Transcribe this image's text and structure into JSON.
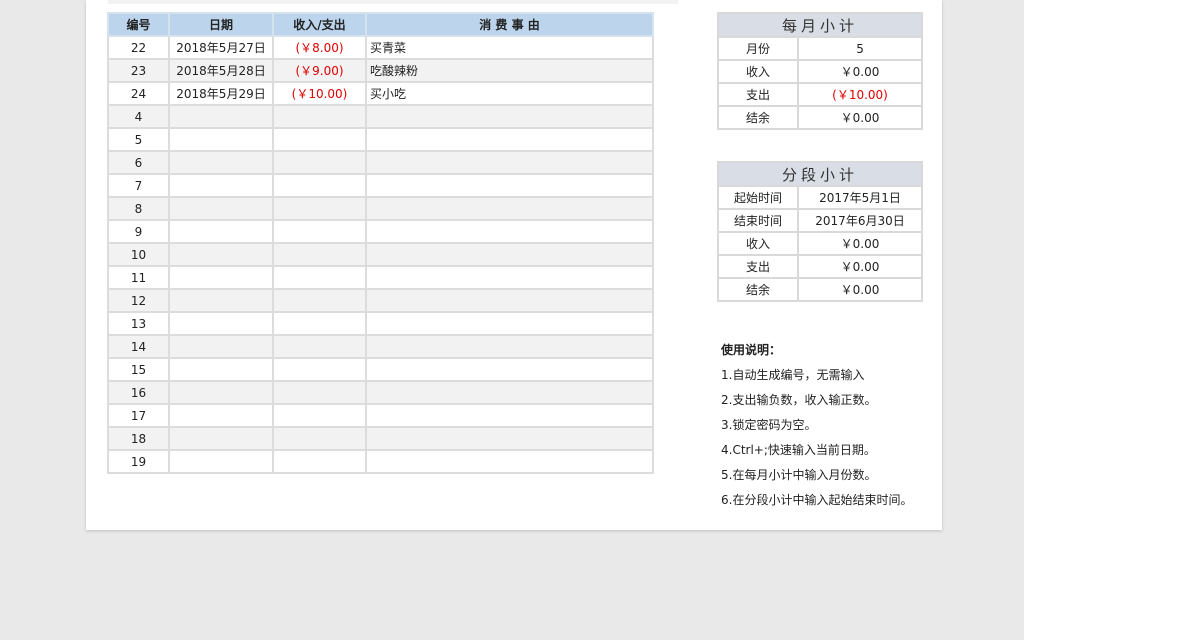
{
  "ledger": {
    "headers": {
      "no": "编号",
      "date": "日期",
      "amount": "收入/支出",
      "reason": "消 费 事 由"
    },
    "rows": [
      {
        "no": "22",
        "date": "2018年5月27日",
        "amount": "(￥8.00)",
        "reason": "买青菜"
      },
      {
        "no": "23",
        "date": "2018年5月28日",
        "amount": "(￥9.00)",
        "reason": "吃酸辣粉"
      },
      {
        "no": "24",
        "date": "2018年5月29日",
        "amount": "(￥10.00)",
        "reason": "买小吃"
      },
      {
        "no": "4",
        "date": "",
        "amount": "",
        "reason": ""
      },
      {
        "no": "5",
        "date": "",
        "amount": "",
        "reason": ""
      },
      {
        "no": "6",
        "date": "",
        "amount": "",
        "reason": ""
      },
      {
        "no": "7",
        "date": "",
        "amount": "",
        "reason": ""
      },
      {
        "no": "8",
        "date": "",
        "amount": "",
        "reason": ""
      },
      {
        "no": "9",
        "date": "",
        "amount": "",
        "reason": ""
      },
      {
        "no": "10",
        "date": "",
        "amount": "",
        "reason": ""
      },
      {
        "no": "11",
        "date": "",
        "amount": "",
        "reason": ""
      },
      {
        "no": "12",
        "date": "",
        "amount": "",
        "reason": ""
      },
      {
        "no": "13",
        "date": "",
        "amount": "",
        "reason": ""
      },
      {
        "no": "14",
        "date": "",
        "amount": "",
        "reason": ""
      },
      {
        "no": "15",
        "date": "",
        "amount": "",
        "reason": ""
      },
      {
        "no": "16",
        "date": "",
        "amount": "",
        "reason": ""
      },
      {
        "no": "17",
        "date": "",
        "amount": "",
        "reason": ""
      },
      {
        "no": "18",
        "date": "",
        "amount": "",
        "reason": ""
      },
      {
        "no": "19",
        "date": "",
        "amount": "",
        "reason": ""
      }
    ]
  },
  "monthly": {
    "title": "每月小计",
    "rows": [
      {
        "label": "月份",
        "value": "5"
      },
      {
        "label": "收入",
        "value": "￥0.00"
      },
      {
        "label": "支出",
        "value": "(￥10.00)"
      },
      {
        "label": "结余",
        "value": "￥0.00"
      }
    ]
  },
  "period": {
    "title": "分段小计",
    "rows": [
      {
        "label": "起始时间",
        "value": "2017年5月1日"
      },
      {
        "label": "结束时间",
        "value": "2017年6月30日"
      },
      {
        "label": "收入",
        "value": "￥0.00"
      },
      {
        "label": "支出",
        "value": "￥0.00"
      },
      {
        "label": "结余",
        "value": "￥0.00"
      }
    ]
  },
  "notes": {
    "title": "使用说明：",
    "items": [
      "1.自动生成编号，无需输入",
      "2.支出输负数，收入输正数。",
      "3.锁定密码为空。",
      "4.Ctrl+;快速输入当前日期。",
      "5.在每月小计中输入月份数。",
      "6.在分段小计中输入起始结束时间。"
    ]
  },
  "colors": {
    "header_bg": "#bcd5ec",
    "panel_header_bg": "#d9dee6",
    "negative": "#e00000",
    "stripe": "#f2f2f2",
    "canvas": "#e9e9e9"
  }
}
